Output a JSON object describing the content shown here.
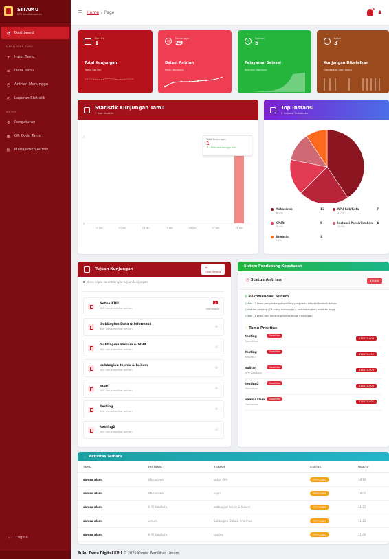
{
  "app": {
    "name": "SITAMU",
    "subtitle": "KPU Kota/Kabupaten"
  },
  "topbar": {
    "home": "Home",
    "separator": "/",
    "page": "Page"
  },
  "sidebar": {
    "items": [
      {
        "label": "Dashboard",
        "icon": "dashboard-icon"
      },
      {
        "section": "MANAJEMEN TAMU"
      },
      {
        "label": "Input Tamu",
        "icon": "user-plus-icon"
      },
      {
        "label": "Data Tamu",
        "icon": "list-icon"
      },
      {
        "label": "Antrian Menunggu",
        "icon": "clock-icon"
      },
      {
        "label": "Laporan Statistik",
        "icon": "chart-icon"
      },
      {
        "section": "SISTEM"
      },
      {
        "label": "Pengaturan",
        "icon": "gear-icon"
      },
      {
        "label": "QR Code Tamu",
        "icon": "qr-icon"
      },
      {
        "label": "Manajemen Admin",
        "icon": "admin-icon"
      }
    ],
    "logout": "Logout"
  },
  "stats": [
    {
      "label": "Hari Ini",
      "value": "1",
      "title": "Total Kunjungan",
      "sub": "Tamu hari ini",
      "color": "#b5121b"
    },
    {
      "label": "Menunggu",
      "value": "29",
      "title": "Dalam Antrian",
      "sub": "Perlu diproses",
      "color": "#ef3e52"
    },
    {
      "label": "Selesai",
      "value": "5",
      "title": "Pelayanan Selesai",
      "sub": "Berhasil diproses",
      "color": "#26b53c"
    },
    {
      "label": "Batal",
      "value": "3",
      "title": "Kunjungan Dibatalkan",
      "sub": "Dibatalkan oleh tamu",
      "color": "#9a4a1d"
    }
  ],
  "statistik": {
    "title": "Statistik Kunjungan Tamu",
    "subtitle": "7 Hari Terakhir",
    "tooltip": {
      "label": "Total Kunjungan",
      "value": "1",
      "note": "+10% dari minggu lalu"
    }
  },
  "chart_data": {
    "type": "bar",
    "categories": [
      "22 Jan",
      "23 Jan",
      "24 Jan",
      "25 Jan",
      "26 Jan",
      "27 Jan",
      "28 Jan"
    ],
    "values": [
      0,
      0,
      0,
      0,
      0,
      0,
      1
    ],
    "yticks": [
      "0",
      "1"
    ],
    "ylim": [
      0,
      1
    ],
    "color": "#f28b87"
  },
  "top_instansi": {
    "title": "Top Instansi",
    "subtitle": "5 Instansi Terbanyak",
    "chart_data": {
      "type": "pie",
      "series": [
        {
          "name": "Mahasiswa",
          "pct": "40.6%",
          "count": 13,
          "color": "#8b1520"
        },
        {
          "name": "KPU Kab/Kota",
          "pct": "21.9%",
          "count": 7,
          "color": "#b8243a"
        },
        {
          "name": "KPURI",
          "pct": "15.6%",
          "count": 5,
          "color": "#e23a52"
        },
        {
          "name": "Instansi Pemerintahan",
          "pct": "12.5%",
          "count": 4,
          "color": "#cf6a74"
        },
        {
          "name": "Bawaslu",
          "pct": "9.4%",
          "count": 3,
          "color": "#fc6a1f"
        }
      ]
    }
  },
  "tujuan": {
    "title": "Tujuan Kunjungan",
    "button": "Lihat Semua",
    "info": "Akses cepat ke antrian per tujuan kunjungan",
    "items": [
      {
        "name": "ketua KPU",
        "sub": "Klik untuk melihat antrian",
        "badge": "2",
        "right": "menunggu"
      },
      {
        "name": "Subbagian Data & Informasi",
        "sub": "Klik untuk melihat antrian"
      },
      {
        "name": "Subbagian Hukum & SDM",
        "sub": "Klik untuk melihat antrian"
      },
      {
        "name": "subbagian teknis & hukum",
        "sub": "Klik untuk melihat antrian"
      },
      {
        "name": "supri",
        "sub": "Klik untuk melihat antrian"
      },
      {
        "name": "testing",
        "sub": "Klik untuk melihat antrian"
      },
      {
        "name": "testing2",
        "sub": "Klik untuk melihat antrian"
      }
    ]
  },
  "spk": {
    "title": "Sistem Pendukung Keputusan",
    "status_title": "Status Antrian",
    "status_badge": "Kritikal",
    "rekomendasi_title": "Rekomendasi Sistem",
    "rekomendasi": [
      "Ada 17 tamu penyandang disabilitas yang perlu dilayani terlebih dahulu",
      "Antrian panjang (29 orang menunggu) - pertimbangkan prioritas tinggi",
      "Ada 18 tamu dari instansi prioritas tinggi menunggu"
    ],
    "prioritas_title": "Tamu Prioritas",
    "prioritas": [
      {
        "name": "testing",
        "tag": "Disabilitas",
        "sub": "Mahasiswa",
        "code": "270125-006"
      },
      {
        "name": "testing",
        "tag": "Disabilitas",
        "sub": "Bawaslu",
        "code": "310125-002"
      },
      {
        "name": "sulitan",
        "tag": "Disabilitas",
        "sub": "KPU Kab/Kota",
        "code": "310125-003"
      },
      {
        "name": "testing2",
        "tag": "Disabilitas",
        "sub": "Mahasiswa",
        "code": "310125-004"
      },
      {
        "name": "samsu alam",
        "tag": "Disabilitas",
        "sub": "Mahasiswa",
        "code": "270125-001"
      }
    ]
  },
  "aktivitas": {
    "title": "Aktivitas Terbaru",
    "columns": [
      "TAMU",
      "INSTANSI",
      "TUJUAN",
      "STATUS",
      "WAKTU"
    ],
    "rows": [
      [
        "samsu alam",
        "Mahasiswa",
        "ketua KPU",
        "menunggu",
        "18.10"
      ],
      [
        "samsu alam",
        "Mahasiswa",
        "supri",
        "menunggu",
        "18.02"
      ],
      [
        "samsu alam",
        "KPU Kab/Kota",
        "subbagian teknis & hukum",
        "menunggu",
        "11.22"
      ],
      [
        "samsu alam",
        "umum",
        "Subbagian Data & Informasi",
        "menunggu",
        "11.22"
      ],
      [
        "samsu alam",
        "KPU Kab/Kota",
        "testing",
        "menunggu",
        "11.00"
      ]
    ]
  },
  "footer": {
    "brand": "Buku Tamu Digital KPU",
    "text": "© 2025 Komisi Pemilihan Umum."
  }
}
